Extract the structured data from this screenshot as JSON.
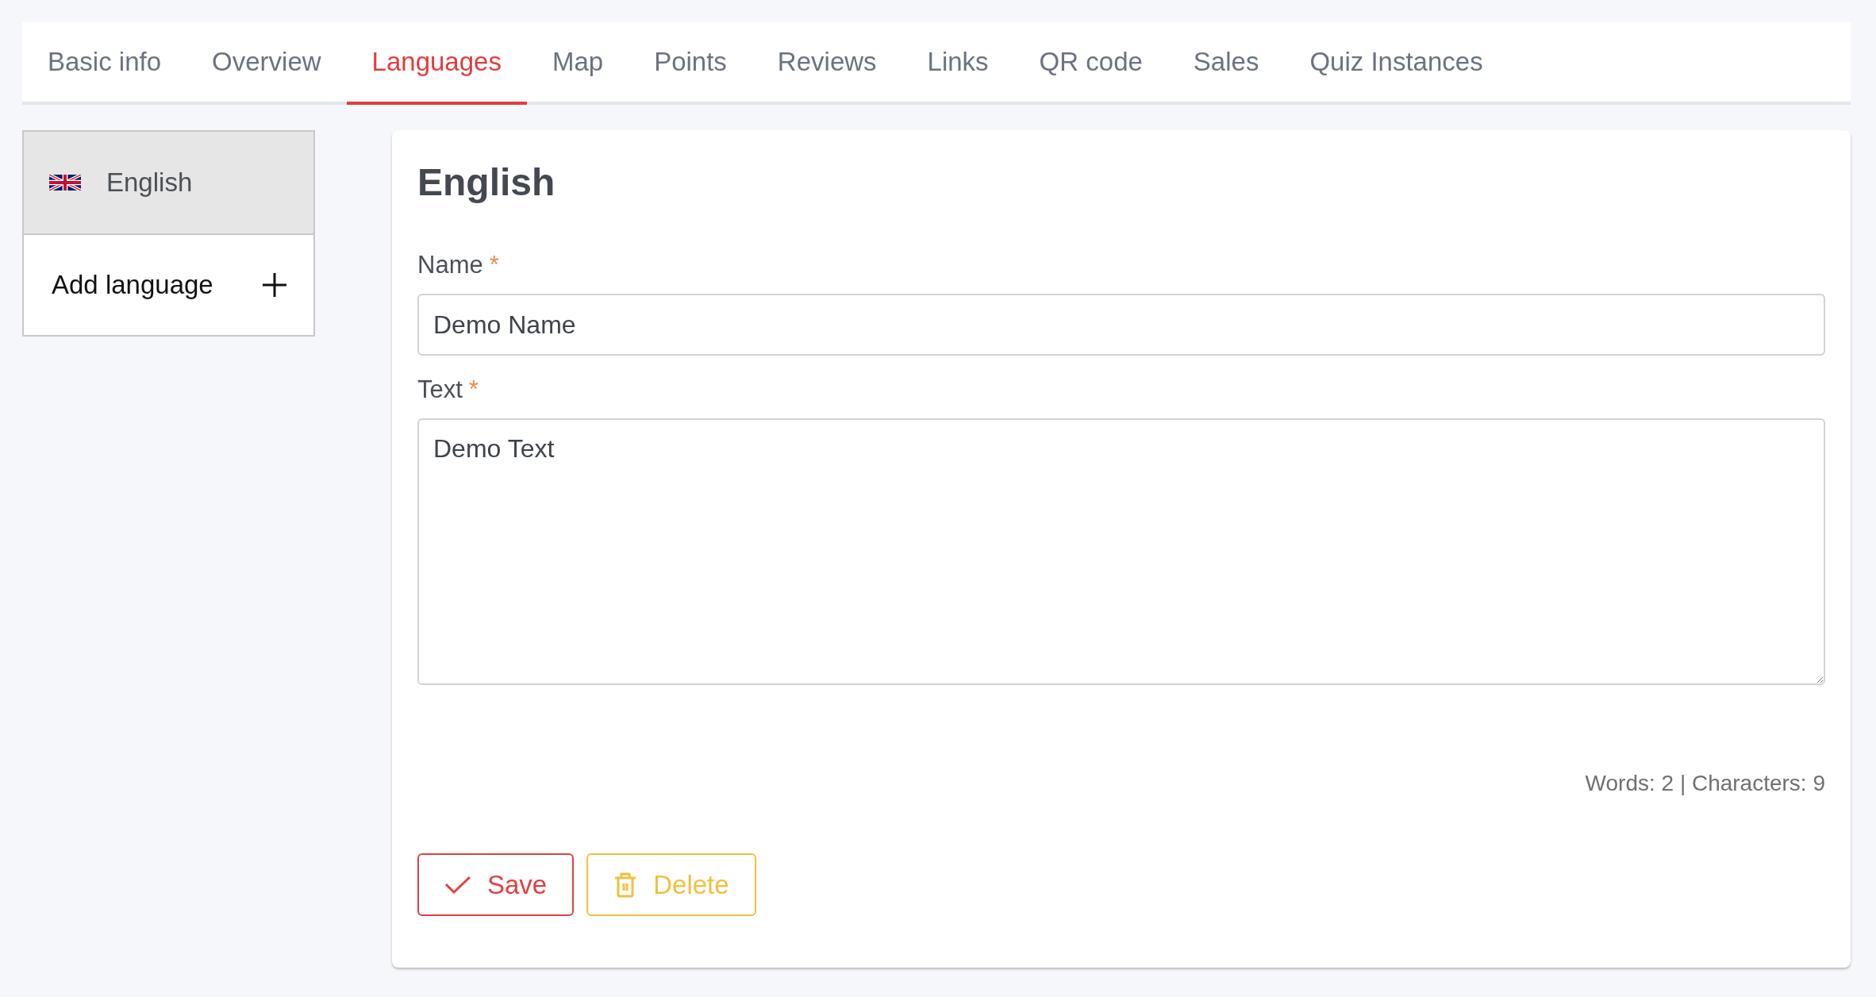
{
  "tabs": [
    {
      "label": "Basic info",
      "selected": false
    },
    {
      "label": "Overview",
      "selected": false
    },
    {
      "label": "Languages",
      "selected": true
    },
    {
      "label": "Map",
      "selected": false
    },
    {
      "label": "Points",
      "selected": false
    },
    {
      "label": "Reviews",
      "selected": false
    },
    {
      "label": "Links",
      "selected": false
    },
    {
      "label": "QR code",
      "selected": false
    },
    {
      "label": "Sales",
      "selected": false
    },
    {
      "label": "Quiz Instances",
      "selected": false
    }
  ],
  "sidebar": {
    "languages": [
      {
        "label": "English",
        "selected": true
      }
    ],
    "add_label": "Add language"
  },
  "editor": {
    "title": "English",
    "fields": [
      {
        "kind": "input",
        "label": "Name",
        "required_mark": "*",
        "value": "Demo Name"
      },
      {
        "kind": "textarea",
        "label": "Text",
        "required_mark": "*",
        "value": "Demo Text"
      }
    ],
    "counter": "Words: 2 | Characters: 9",
    "buttons": [
      {
        "kind": "save",
        "label": "Save"
      },
      {
        "kind": "delete",
        "label": "Delete"
      }
    ]
  }
}
